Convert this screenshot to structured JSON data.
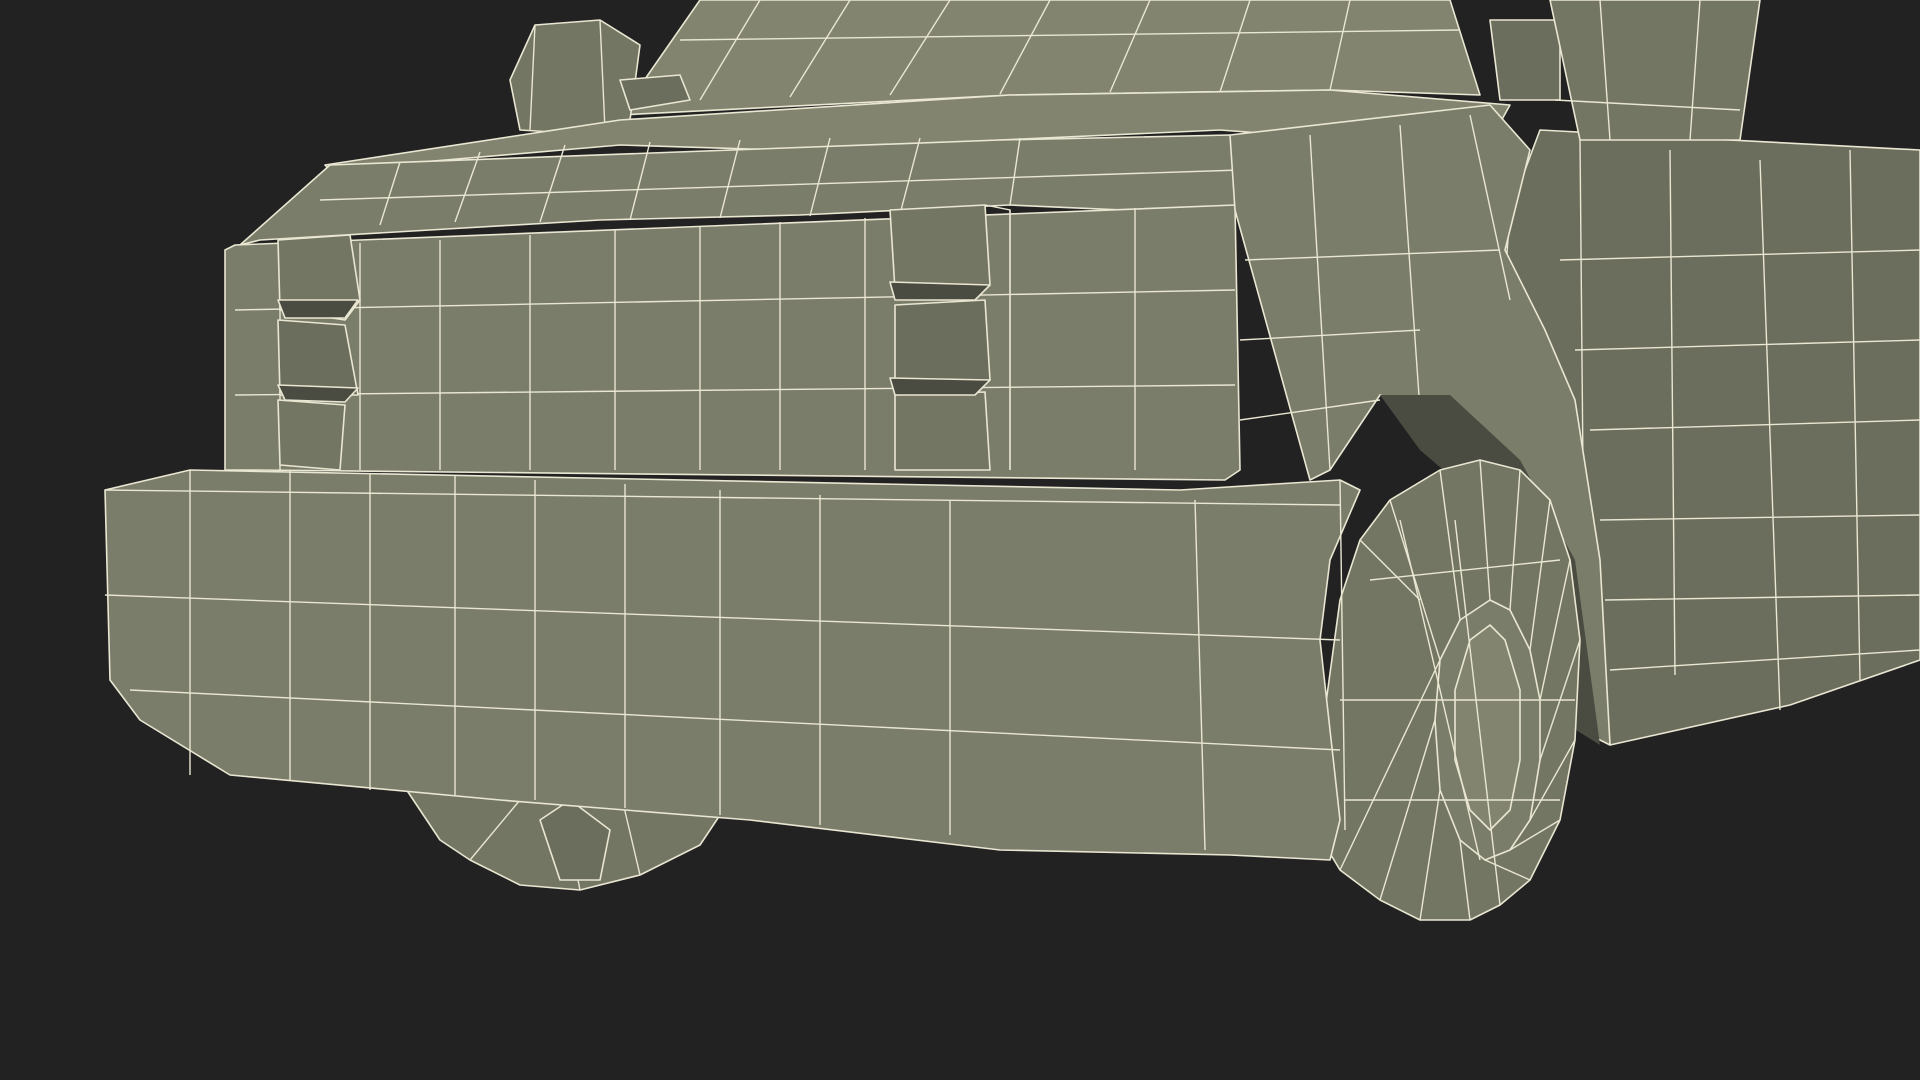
{
  "scene": {
    "subject": "wireframe-mesh-vehicle-front",
    "background_color": "#222222",
    "surface_color": "#7b7d6b",
    "wire_color": "#e9e6d2"
  }
}
